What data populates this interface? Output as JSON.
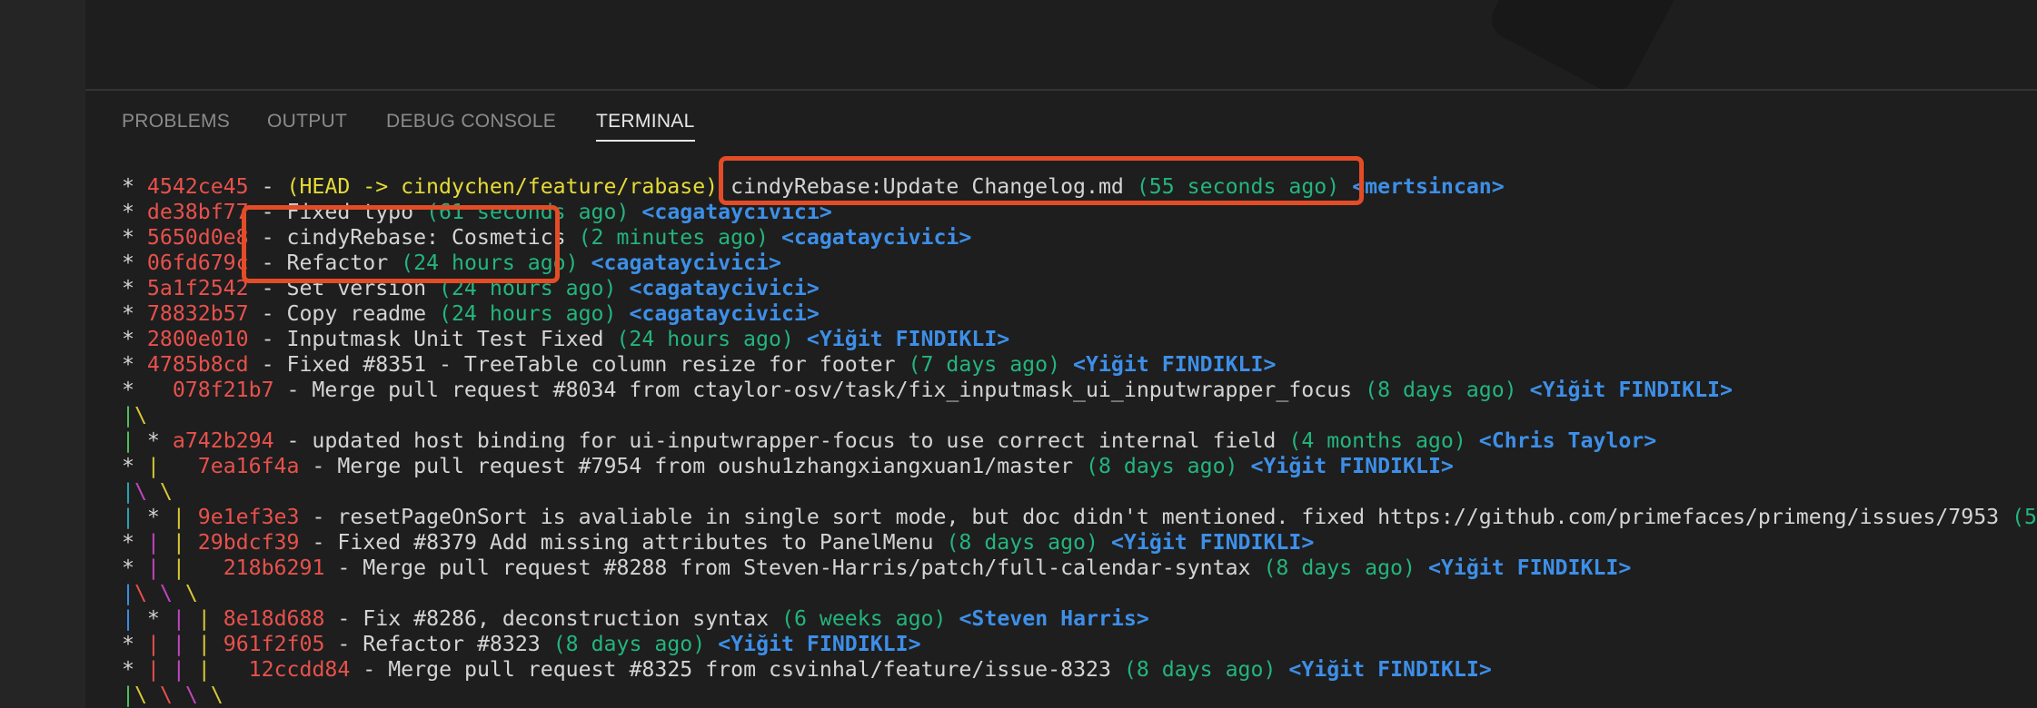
{
  "panel": {
    "tabs": [
      {
        "label": "PROBLEMS",
        "active": false
      },
      {
        "label": "OUTPUT",
        "active": false
      },
      {
        "label": "DEBUG CONSOLE",
        "active": false
      },
      {
        "label": "TERMINAL",
        "active": true
      }
    ]
  },
  "colors": {
    "hash": "#e8514c",
    "time": "#23b57e",
    "author": "#3d8fe8",
    "head": "#e6db36",
    "highlight": "#e34c26"
  },
  "terminal": {
    "lines": [
      [
        {
          "c": "star",
          "t": "* "
        },
        {
          "c": "hash",
          "t": "4542ce45"
        },
        {
          "c": "",
          "t": " - "
        },
        {
          "c": "head",
          "t": "(HEAD -> cindychen/feature/rabase)"
        },
        {
          "c": "",
          "t": " cindyRebase:Update Changelog.md "
        },
        {
          "c": "time",
          "t": "(55 seconds ago)"
        },
        {
          "c": "",
          "t": " "
        },
        {
          "c": "author",
          "t": "<mertsincan>"
        }
      ],
      [
        {
          "c": "star",
          "t": "* "
        },
        {
          "c": "hash",
          "t": "de38bf77"
        },
        {
          "c": "",
          "t": " - Fixed typo "
        },
        {
          "c": "time",
          "t": "(61 seconds ago)"
        },
        {
          "c": "",
          "t": " "
        },
        {
          "c": "author",
          "t": "<cagataycivici>"
        }
      ],
      [
        {
          "c": "star",
          "t": "* "
        },
        {
          "c": "hash",
          "t": "5650d0e8"
        },
        {
          "c": "",
          "t": " - cindyRebase: Cosmetics "
        },
        {
          "c": "time",
          "t": "(2 minutes ago)"
        },
        {
          "c": "",
          "t": " "
        },
        {
          "c": "author",
          "t": "<cagataycivici>"
        }
      ],
      [
        {
          "c": "star",
          "t": "* "
        },
        {
          "c": "hash",
          "t": "06fd679c"
        },
        {
          "c": "",
          "t": " - Refactor "
        },
        {
          "c": "time",
          "t": "(24 hours ago)"
        },
        {
          "c": "",
          "t": " "
        },
        {
          "c": "author",
          "t": "<cagataycivici>"
        }
      ],
      [
        {
          "c": "star",
          "t": "* "
        },
        {
          "c": "hash",
          "t": "5a1f2542"
        },
        {
          "c": "",
          "t": " - Set version "
        },
        {
          "c": "time",
          "t": "(24 hours ago)"
        },
        {
          "c": "",
          "t": " "
        },
        {
          "c": "author",
          "t": "<cagataycivici>"
        }
      ],
      [
        {
          "c": "star",
          "t": "* "
        },
        {
          "c": "hash",
          "t": "78832b57"
        },
        {
          "c": "",
          "t": " - Copy readme "
        },
        {
          "c": "time",
          "t": "(24 hours ago)"
        },
        {
          "c": "",
          "t": " "
        },
        {
          "c": "author",
          "t": "<cagataycivici>"
        }
      ],
      [
        {
          "c": "star",
          "t": "* "
        },
        {
          "c": "hash",
          "t": "2800e010"
        },
        {
          "c": "",
          "t": " - Inputmask Unit Test Fixed "
        },
        {
          "c": "time",
          "t": "(24 hours ago)"
        },
        {
          "c": "",
          "t": " "
        },
        {
          "c": "author",
          "t": "<Yiğit FINDIKLI>"
        }
      ],
      [
        {
          "c": "star",
          "t": "* "
        },
        {
          "c": "hash",
          "t": "4785b8cd"
        },
        {
          "c": "",
          "t": " - Fixed #8351 - TreeTable column resize for footer "
        },
        {
          "c": "time",
          "t": "(7 days ago)"
        },
        {
          "c": "",
          "t": " "
        },
        {
          "c": "author",
          "t": "<Yiğit FINDIKLI>"
        }
      ],
      [
        {
          "c": "star",
          "t": "*   "
        },
        {
          "c": "hash",
          "t": "078f21b7"
        },
        {
          "c": "",
          "t": " - Merge pull request #8034 from ctaylor-osv/task/fix_inputmask_ui_inputwrapper_focus "
        },
        {
          "c": "time",
          "t": "(8 days ago)"
        },
        {
          "c": "",
          "t": " "
        },
        {
          "c": "author",
          "t": "<Yiğit FINDIKLI>"
        }
      ],
      [
        {
          "c": "g-green",
          "t": "|"
        },
        {
          "c": "g-yellow",
          "t": "\\"
        }
      ],
      [
        {
          "c": "g-green",
          "t": "|"
        },
        {
          "c": "star",
          "t": " * "
        },
        {
          "c": "hash",
          "t": "a742b294"
        },
        {
          "c": "",
          "t": " - updated host binding for ui-inputwrapper-focus to use correct internal field "
        },
        {
          "c": "time",
          "t": "(4 months ago)"
        },
        {
          "c": "",
          "t": " "
        },
        {
          "c": "author",
          "t": "<Chris Taylor>"
        }
      ],
      [
        {
          "c": "star",
          "t": "* "
        },
        {
          "c": "g-yellow",
          "t": "|"
        },
        {
          "c": "",
          "t": "   "
        },
        {
          "c": "hash",
          "t": "7ea16f4a"
        },
        {
          "c": "",
          "t": " - Merge pull request #7954 from oushu1zhangxiangxuan1/master "
        },
        {
          "c": "time",
          "t": "(8 days ago)"
        },
        {
          "c": "",
          "t": " "
        },
        {
          "c": "author",
          "t": "<Yiğit FINDIKLI>"
        }
      ],
      [
        {
          "c": "g-cyan",
          "t": "|"
        },
        {
          "c": "g-mag",
          "t": "\\"
        },
        {
          "c": "",
          "t": " "
        },
        {
          "c": "g-yellow",
          "t": "\\"
        }
      ],
      [
        {
          "c": "g-cyan",
          "t": "|"
        },
        {
          "c": "star",
          "t": " * "
        },
        {
          "c": "g-yellow",
          "t": "|"
        },
        {
          "c": "",
          "t": " "
        },
        {
          "c": "hash",
          "t": "9e1ef3e3"
        },
        {
          "c": "",
          "t": " - resetPageOnSort is avaliable in single sort mode, but doc didn't mentioned. fixed https://github.com/primefaces/primeng/issues/7953 "
        },
        {
          "c": "time",
          "t": "(5"
        }
      ],
      [
        {
          "c": "star",
          "t": "* "
        },
        {
          "c": "g-mag",
          "t": "|"
        },
        {
          "c": "",
          "t": " "
        },
        {
          "c": "g-yellow",
          "t": "|"
        },
        {
          "c": "",
          "t": " "
        },
        {
          "c": "hash",
          "t": "29bdcf39"
        },
        {
          "c": "",
          "t": " - Fixed #8379 Add missing attributes to PanelMenu "
        },
        {
          "c": "time",
          "t": "(8 days ago)"
        },
        {
          "c": "",
          "t": " "
        },
        {
          "c": "author",
          "t": "<Yiğit FINDIKLI>"
        }
      ],
      [
        {
          "c": "star",
          "t": "* "
        },
        {
          "c": "g-mag",
          "t": "|"
        },
        {
          "c": "",
          "t": " "
        },
        {
          "c": "g-yellow",
          "t": "|"
        },
        {
          "c": "",
          "t": "   "
        },
        {
          "c": "hash",
          "t": "218b6291"
        },
        {
          "c": "",
          "t": " - Merge pull request #8288 from Steven-Harris/patch/full-calendar-syntax "
        },
        {
          "c": "time",
          "t": "(8 days ago)"
        },
        {
          "c": "",
          "t": " "
        },
        {
          "c": "author",
          "t": "<Yiğit FINDIKLI>"
        }
      ],
      [
        {
          "c": "g-blue",
          "t": "|"
        },
        {
          "c": "g-red",
          "t": "\\"
        },
        {
          "c": "",
          "t": " "
        },
        {
          "c": "g-mag",
          "t": "\\"
        },
        {
          "c": "",
          "t": " "
        },
        {
          "c": "g-yellow",
          "t": "\\"
        }
      ],
      [
        {
          "c": "g-blue",
          "t": "|"
        },
        {
          "c": "star",
          "t": " * "
        },
        {
          "c": "g-mag",
          "t": "|"
        },
        {
          "c": "",
          "t": " "
        },
        {
          "c": "g-yellow",
          "t": "|"
        },
        {
          "c": "",
          "t": " "
        },
        {
          "c": "hash",
          "t": "8e18d688"
        },
        {
          "c": "",
          "t": " - Fix #8286, deconstruction syntax "
        },
        {
          "c": "time",
          "t": "(6 weeks ago)"
        },
        {
          "c": "",
          "t": " "
        },
        {
          "c": "author",
          "t": "<Steven Harris>"
        }
      ],
      [
        {
          "c": "star",
          "t": "* "
        },
        {
          "c": "g-red",
          "t": "|"
        },
        {
          "c": "",
          "t": " "
        },
        {
          "c": "g-mag",
          "t": "|"
        },
        {
          "c": "",
          "t": " "
        },
        {
          "c": "g-yellow",
          "t": "|"
        },
        {
          "c": "",
          "t": " "
        },
        {
          "c": "hash",
          "t": "961f2f05"
        },
        {
          "c": "",
          "t": " - Refactor #8323 "
        },
        {
          "c": "time",
          "t": "(8 days ago)"
        },
        {
          "c": "",
          "t": " "
        },
        {
          "c": "author",
          "t": "<Yiğit FINDIKLI>"
        }
      ],
      [
        {
          "c": "star",
          "t": "* "
        },
        {
          "c": "g-red",
          "t": "|"
        },
        {
          "c": "",
          "t": " "
        },
        {
          "c": "g-mag",
          "t": "|"
        },
        {
          "c": "",
          "t": " "
        },
        {
          "c": "g-yellow",
          "t": "|"
        },
        {
          "c": "",
          "t": "   "
        },
        {
          "c": "hash",
          "t": "12ccdd84"
        },
        {
          "c": "",
          "t": " - Merge pull request #8325 from csvinhal/feature/issue-8323 "
        },
        {
          "c": "time",
          "t": "(8 days ago)"
        },
        {
          "c": "",
          "t": " "
        },
        {
          "c": "author",
          "t": "<Yiğit FINDIKLI>"
        }
      ],
      [
        {
          "c": "g-green",
          "t": "|"
        },
        {
          "c": "g-yellow",
          "t": "\\"
        },
        {
          "c": "",
          "t": " "
        },
        {
          "c": "g-red",
          "t": "\\"
        },
        {
          "c": "",
          "t": " "
        },
        {
          "c": "g-mag",
          "t": "\\"
        },
        {
          "c": "",
          "t": " "
        },
        {
          "c": "g-yellow",
          "t": "\\"
        }
      ]
    ]
  }
}
